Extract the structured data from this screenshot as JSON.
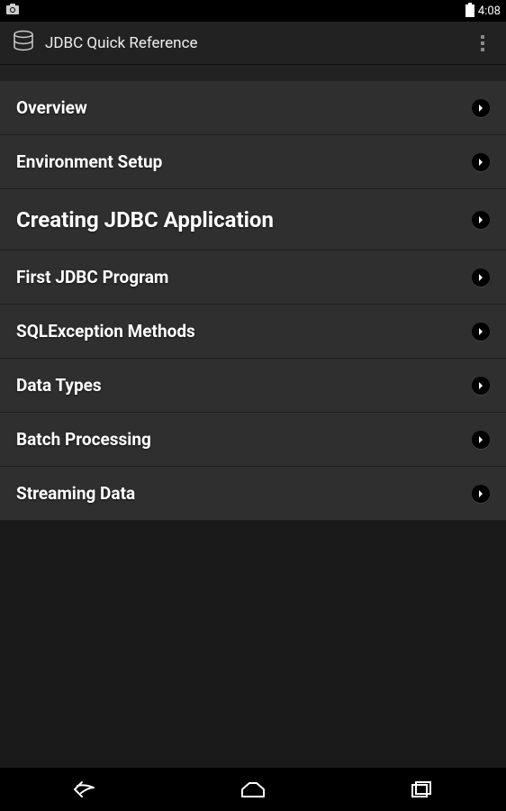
{
  "status": {
    "time": "4:08"
  },
  "header": {
    "title": "JDBC Quick Reference"
  },
  "items": [
    {
      "label": "Overview",
      "large": false
    },
    {
      "label": "Environment Setup",
      "large": false
    },
    {
      "label": "Creating JDBC Application",
      "large": true
    },
    {
      "label": "First JDBC Program",
      "large": false
    },
    {
      "label": "SQLException Methods",
      "large": false
    },
    {
      "label": "Data Types",
      "large": false
    },
    {
      "label": "Batch Processing",
      "large": false
    },
    {
      "label": "Streaming Data",
      "large": false
    }
  ]
}
